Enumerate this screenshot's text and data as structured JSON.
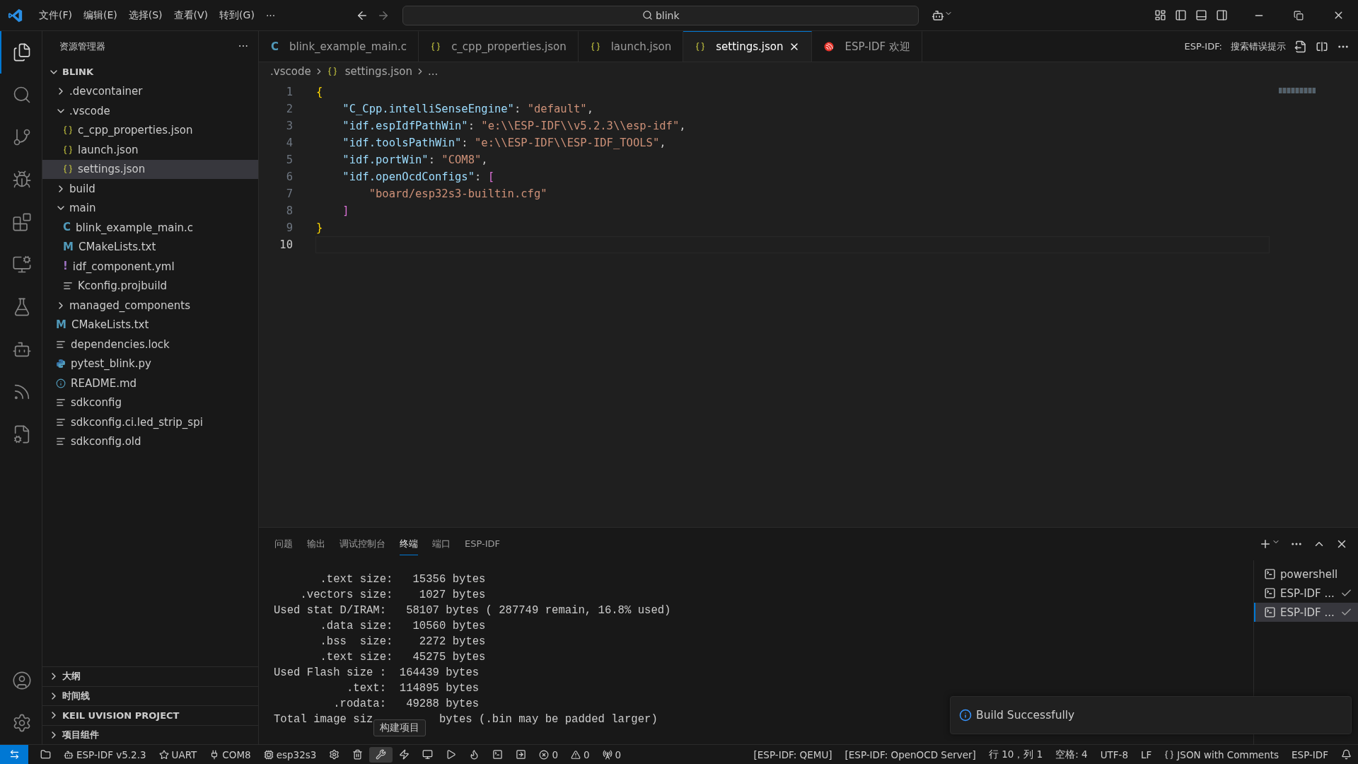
{
  "title_bar": {
    "menus": [
      "文件(F)",
      "编辑(E)",
      "选择(S)",
      "查看(V)",
      "转到(G)",
      "···"
    ],
    "search": {
      "value": "blink"
    }
  },
  "activity_bar": {
    "items": [
      {
        "selected": true
      },
      {
        "selected": false
      },
      {
        "selected": false
      },
      {
        "selected": false
      },
      {
        "selected": false
      },
      {
        "selected": false
      },
      {
        "selected": false
      },
      {
        "selected": false
      },
      {
        "selected": false
      },
      {
        "selected": false
      }
    ]
  },
  "sidebar": {
    "title": "资源管理器",
    "more": "···",
    "root": "BLINK",
    "items": [
      {
        "name": ".devcontainer",
        "kind": "folder",
        "expanded": false,
        "selected": false
      },
      {
        "name": ".vscode",
        "kind": "folder",
        "expanded": true,
        "selected": false,
        "children": [
          {
            "name": "c_cpp_properties.json",
            "kind": "json",
            "selected": false
          },
          {
            "name": "launch.json",
            "kind": "json",
            "selected": false
          },
          {
            "name": "settings.json",
            "kind": "json",
            "selected": true
          }
        ]
      },
      {
        "name": "build",
        "kind": "folder",
        "expanded": false,
        "selected": false
      },
      {
        "name": "main",
        "kind": "folder",
        "expanded": true,
        "selected": false,
        "children": [
          {
            "name": "blink_example_main.c",
            "kind": "glyph",
            "glyph": "C",
            "color": "#519aba",
            "selected": false
          },
          {
            "name": "CMakeLists.txt",
            "kind": "glyph",
            "glyph": "M",
            "color": "#519aba",
            "selected": false
          },
          {
            "name": "idf_component.yml",
            "kind": "glyph",
            "glyph": "!",
            "color": "#a074c4",
            "selected": false
          },
          {
            "name": "Kconfig.projbuild",
            "kind": "text",
            "selected": false
          }
        ]
      },
      {
        "name": "managed_components",
        "kind": "folder",
        "expanded": false,
        "selected": false
      },
      {
        "name": "CMakeLists.txt",
        "kind": "glyph",
        "glyph": "M",
        "color": "#519aba",
        "selected": false
      },
      {
        "name": "dependencies.lock",
        "kind": "text",
        "selected": false
      },
      {
        "name": "pytest_blink.py",
        "kind": "python",
        "selected": false
      },
      {
        "name": "README.md",
        "kind": "info",
        "selected": false
      },
      {
        "name": "sdkconfig",
        "kind": "text",
        "selected": false
      },
      {
        "name": "sdkconfig.ci.led_strip_spi",
        "kind": "text",
        "selected": false
      },
      {
        "name": "sdkconfig.old",
        "kind": "text",
        "selected": false
      }
    ],
    "sections": [
      "大纲",
      "时间线",
      "KEIL UVISION PROJECT",
      "项目组件"
    ]
  },
  "tabs": [
    {
      "label": "blink_example_main.c",
      "kind": "glyph",
      "glyph": "C",
      "selected": false
    },
    {
      "label": "c_cpp_properties.json",
      "kind": "json",
      "selected": false
    },
    {
      "label": "launch.json",
      "kind": "json",
      "selected": false
    },
    {
      "label": "settings.json",
      "kind": "json",
      "selected": true
    },
    {
      "label": "ESP-IDF 欢迎",
      "kind": "espressif",
      "selected": false
    }
  ],
  "editor_actions": {
    "prefix": "ESP-IDF:",
    "label": "搜索错误提示"
  },
  "breadcrumb": [
    {
      "label": ".vscode",
      "kind": "folder"
    },
    {
      "label": "settings.json",
      "kind": "json"
    },
    {
      "label": "...",
      "kind": "more"
    }
  ],
  "editor": {
    "lines": [
      {
        "number": "1",
        "current": false,
        "tokens": [
          {
            "text": "{",
            "kind": "brace"
          }
        ]
      },
      {
        "number": "2",
        "current": false,
        "tokens": [
          {
            "text": "    \"C_Cpp.intelliSenseEngine\"",
            "kind": "key"
          },
          {
            "text": ": ",
            "kind": "punct"
          },
          {
            "text": "\"default\"",
            "kind": "string"
          },
          {
            "text": ",",
            "kind": "punct"
          }
        ]
      },
      {
        "number": "3",
        "current": false,
        "tokens": [
          {
            "text": "    \"idf.espIdfPathWin\"",
            "kind": "key"
          },
          {
            "text": ": ",
            "kind": "punct"
          },
          {
            "text": "\"e:\\\\ESP-IDF\\\\v5.2.3\\\\esp-idf\"",
            "kind": "string"
          },
          {
            "text": ",",
            "kind": "punct"
          }
        ]
      },
      {
        "number": "4",
        "current": false,
        "tokens": [
          {
            "text": "    \"idf.toolsPathWin\"",
            "kind": "key"
          },
          {
            "text": ": ",
            "kind": "punct"
          },
          {
            "text": "\"e:\\\\ESP-IDF\\\\ESP-IDF_TOOLS\"",
            "kind": "string"
          },
          {
            "text": ",",
            "kind": "punct"
          }
        ]
      },
      {
        "number": "5",
        "current": false,
        "tokens": [
          {
            "text": "    \"idf.portWin\"",
            "kind": "key"
          },
          {
            "text": ": ",
            "kind": "punct"
          },
          {
            "text": "\"COM8\"",
            "kind": "string"
          },
          {
            "text": ",",
            "kind": "punct"
          }
        ]
      },
      {
        "number": "6",
        "current": false,
        "tokens": [
          {
            "text": "    \"idf.openOcdConfigs\"",
            "kind": "key"
          },
          {
            "text": ": ",
            "kind": "punct"
          },
          {
            "text": "[",
            "kind": "bracket"
          }
        ]
      },
      {
        "number": "7",
        "current": false,
        "tokens": [
          {
            "text": "        \"board/esp32s3-builtin.cfg\"",
            "kind": "string"
          }
        ]
      },
      {
        "number": "8",
        "current": false,
        "tokens": [
          {
            "text": "    ]",
            "kind": "bracket"
          }
        ]
      },
      {
        "number": "9",
        "current": false,
        "tokens": [
          {
            "text": "}",
            "kind": "brace"
          }
        ]
      },
      {
        "number": "10",
        "current": true
      }
    ]
  },
  "panel": {
    "tabs": [
      {
        "label": "问题",
        "selected": false
      },
      {
        "label": "输出",
        "selected": false
      },
      {
        "label": "调试控制台",
        "selected": false
      },
      {
        "label": "终端",
        "selected": true
      },
      {
        "label": "端口",
        "selected": false
      },
      {
        "label": "ESP-IDF",
        "selected": false
      }
    ],
    "terminal_lines": [
      "       .text size:   15356 bytes",
      "    .vectors size:    1027 bytes",
      "Used stat D/IRAM:   58107 bytes ( 287749 remain, 16.8% used)",
      "       .data size:   10560 bytes",
      "       .bss  size:    2272 bytes",
      "       .text size:   45275 bytes",
      "Used Flash size :  164439 bytes",
      "           .text:  114895 bytes",
      "         .rodata:   49288 bytes"
    ],
    "terminal_last_line": {
      "before": "Total image siz",
      "after": "bytes (.bin may be padded larger)"
    },
    "terminals": [
      {
        "label": "powershell",
        "done": false,
        "selected": false
      },
      {
        "label": "ESP-IDF ...",
        "done": true,
        "selected": false
      },
      {
        "label": "ESP-IDF ...",
        "done": true,
        "selected": true
      }
    ]
  },
  "tooltip": "构建项目",
  "notification": {
    "message": "Build Successfully"
  },
  "status_bar": {
    "left": [
      {
        "kind": "folder"
      },
      {
        "kind": "robot",
        "text": "ESP-IDF v5.2.3"
      },
      {
        "kind": "star",
        "text": "UART"
      },
      {
        "kind": "plug",
        "text": "COM8"
      },
      {
        "kind": "chip",
        "text": "esp32s3"
      },
      {
        "kind": "gear"
      },
      {
        "kind": "trash"
      },
      {
        "kind": "wrench",
        "hovered": true
      },
      {
        "kind": "zap"
      },
      {
        "kind": "monitor"
      },
      {
        "kind": "debug"
      },
      {
        "kind": "flame"
      },
      {
        "kind": "terminal"
      },
      {
        "kind": "box-arrow"
      },
      {
        "kind": "error",
        "text": "0"
      },
      {
        "kind": "warning",
        "text": "0"
      },
      {
        "kind": "antenna",
        "text": "0"
      }
    ],
    "right": [
      {
        "kind": "plain",
        "text": "[ESP-IDF: QEMU]"
      },
      {
        "kind": "plain",
        "text": "[ESP-IDF: OpenOCD Server]"
      },
      {
        "kind": "plain",
        "text": "行 10，列 1"
      },
      {
        "kind": "plain",
        "text": "空格: 4"
      },
      {
        "kind": "plain",
        "text": "UTF-8"
      },
      {
        "kind": "plain",
        "text": "LF"
      },
      {
        "kind": "braces",
        "text": "JSON with Comments"
      },
      {
        "kind": "plain",
        "text": "ESP-IDF"
      },
      {
        "kind": "bell"
      }
    ]
  }
}
